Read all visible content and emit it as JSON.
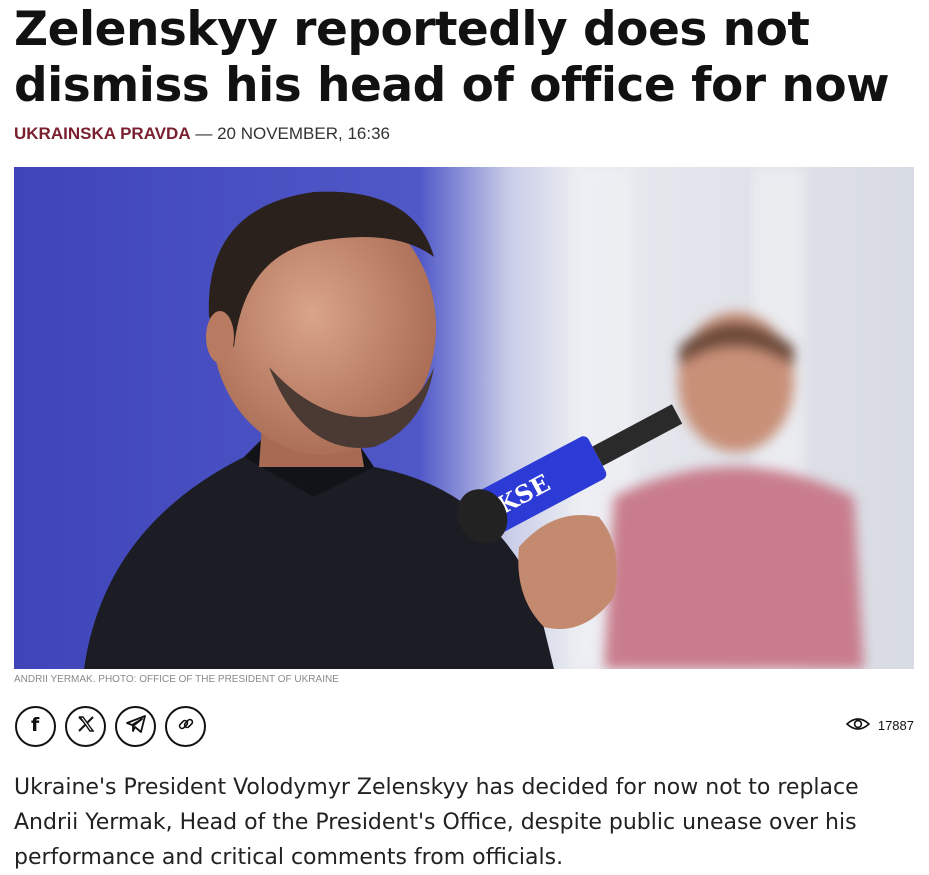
{
  "article": {
    "headline": "Zelenskyy reportedly does not dismiss his head of office for now",
    "source": "UKRAINSKA PRAVDA",
    "separator": " — ",
    "date": "20 NOVEMBER, 16:36",
    "photo_badge": "KSE",
    "caption": "ANDRII YERMAK. PHOTO: OFFICE OF THE PRESIDENT OF UKRAINE",
    "views": "17887",
    "lede": "Ukraine's President Volodymyr Zelenskyy has decided for now not to replace Andrii Yermak, Head of the President's Office, despite public unease over his performance and critical comments from officials."
  },
  "share": {
    "icons": [
      "facebook-icon",
      "x-icon",
      "telegram-icon",
      "link-icon"
    ]
  },
  "colors": {
    "source": "#7a1f2e",
    "photo_background_blue": "#4a4fc4",
    "photo_background_light": "#e6e8ee"
  }
}
